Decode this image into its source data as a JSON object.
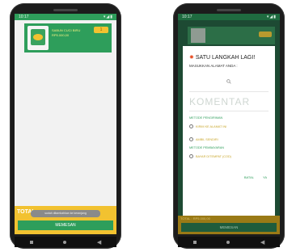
{
  "left": {
    "status": {
      "time": "10:17",
      "icons": "▾◢▮"
    },
    "item": {
      "name": "SABUN CUCI BIRU",
      "price": "RP5.000,00",
      "qty": "1"
    },
    "total_label": "TOTAL",
    "toast": "sudah ditambahkan ke keranjang",
    "order_label": "MEMESAN"
  },
  "right": {
    "status": {
      "time": "10:17",
      "icons": "▾◢▮"
    },
    "dialog": {
      "title": "SATU LANGKAH LAGI!",
      "subtitle": "MASUKKAN ALAMAT ANDA :",
      "comment_hint": "KOMENTAR",
      "shipping_label": "METODE PENGIRIMAN",
      "shipping_options": [
        "KIRIM KE ALAMAT INI",
        "AMBIL SENDIRI"
      ],
      "payment_label": "METODE PEMBAYARAN",
      "payment_options": [
        "BAYAR DITEMPAT (COD)"
      ],
      "cancel": "BATAL",
      "ok": "YA"
    },
    "total_label": "TOTAL : RP5.000,00",
    "order_label": "MEMESAN"
  },
  "colors": {
    "primary": "#2e9e5b",
    "accent": "#f2c230"
  }
}
